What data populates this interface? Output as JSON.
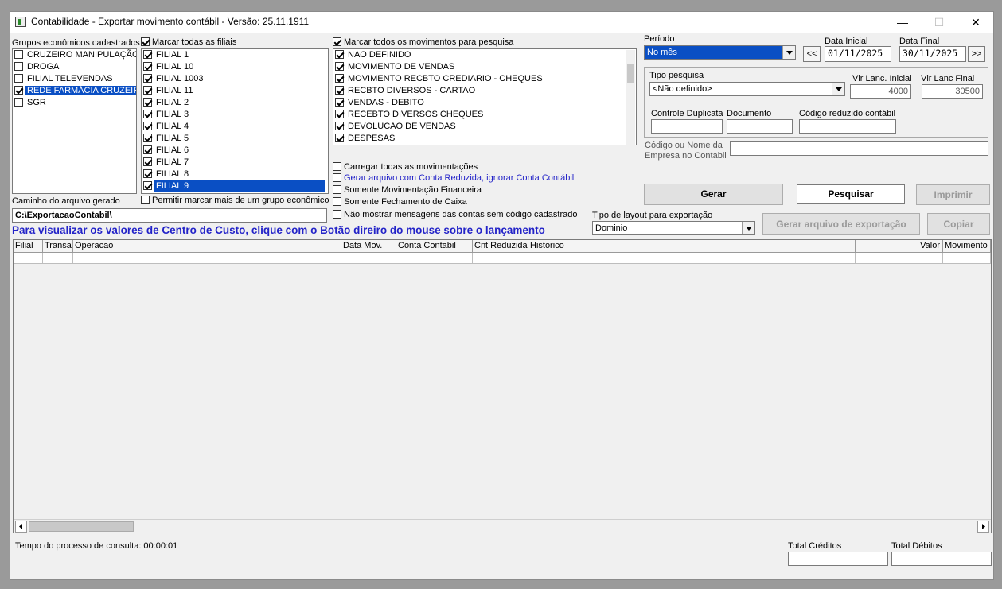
{
  "window": {
    "title": "Contabilidade - Exportar movimento contábil - Versão: 25.11.1911",
    "minimize": "—",
    "maximize": "☐",
    "close": "✕"
  },
  "grupos": {
    "label": "Grupos econômicos cadastrados",
    "items": [
      {
        "label": "CRUZEIRO MANIPULAÇÃO",
        "checked": false,
        "selected": false
      },
      {
        "label": "DROGA",
        "checked": false,
        "selected": false
      },
      {
        "label": "FILIAL TELEVENDAS",
        "checked": false,
        "selected": false
      },
      {
        "label": "REDE FARMÁCIA CRUZEIRO",
        "checked": true,
        "selected": true
      },
      {
        "label": "SGR",
        "checked": false,
        "selected": false
      }
    ]
  },
  "filiais": {
    "label": "Marcar todas as filiais",
    "all_checked": true,
    "items": [
      {
        "label": "FILIAL 1",
        "checked": true,
        "selected": false
      },
      {
        "label": "FILIAL 10",
        "checked": true,
        "selected": false
      },
      {
        "label": "FILIAL 1003",
        "checked": true,
        "selected": false
      },
      {
        "label": "FILIAL 11",
        "checked": true,
        "selected": false
      },
      {
        "label": "FILIAL 2",
        "checked": true,
        "selected": false
      },
      {
        "label": "FILIAL 3",
        "checked": true,
        "selected": false
      },
      {
        "label": "FILIAL 4",
        "checked": true,
        "selected": false
      },
      {
        "label": "FILIAL 5",
        "checked": true,
        "selected": false
      },
      {
        "label": "FILIAL 6",
        "checked": true,
        "selected": false
      },
      {
        "label": "FILIAL 7",
        "checked": true,
        "selected": false
      },
      {
        "label": "FILIAL 8",
        "checked": true,
        "selected": false
      },
      {
        "label": "FILIAL 9",
        "checked": true,
        "selected": true
      }
    ],
    "permitir_label": "Permitir marcar mais de um grupo econômico"
  },
  "movimentos": {
    "label": "Marcar todos os movimentos para pesquisa",
    "all_checked": true,
    "items": [
      "NAO DEFINIDO",
      "MOVIMENTO DE VENDAS",
      "MOVIMENTO RECBTO CREDIARIO - CHEQUES",
      "RECBTO DIVERSOS - CARTAO",
      "VENDAS - DEBITO",
      "RECEBTO DIVERSOS CHEQUES",
      "DEVOLUCAO DE VENDAS",
      "DESPESAS"
    ]
  },
  "opcoes": {
    "carregar": "Carregar todas as movimentações",
    "gerar_reduzida": "Gerar arquivo com Conta Reduzida, ignorar Conta Contábil",
    "somente_financeira": "Somente Movimentação Financeira",
    "somente_fechamento": "Somente Fechamento de Caixa",
    "nao_mostrar": "Não mostrar mensagens das contas sem código cadastrado"
  },
  "caminho": {
    "label": "Caminho do arquivo gerado",
    "value": "C:\\ExportacaoContabil\\"
  },
  "info_text": "Para visualizar os valores de Centro de Custo, clique com o Botão direiro do mouse sobre o lançamento",
  "periodo": {
    "label": "Período",
    "value": "No mês",
    "prev": "<<",
    "next": ">>",
    "data_inicial_label": "Data Inicial",
    "data_inicial": "01/11/2025",
    "data_final_label": "Data Final",
    "data_final": "30/11/2025"
  },
  "pesquisa": {
    "tipo_label": "Tipo pesquisa",
    "tipo_value": "<Não definido>",
    "vlr_inicial_label": "Vlr Lanc. Inicial",
    "vlr_inicial": "4000",
    "vlr_final_label": "Vlr Lanc Final",
    "vlr_final": "30500",
    "controle_label": "Controle Duplicata",
    "documento_label": "Documento",
    "codigo_reduzido_label": "Código reduzido contábil",
    "empresa_label_1": "Código ou Nome da",
    "empresa_label_2": "Empresa no Contabil"
  },
  "buttons": {
    "gerar": "Gerar",
    "pesquisar": "Pesquisar",
    "imprimir": "Imprimir",
    "gerar_arquivo": "Gerar arquivo de exportação",
    "copiar": "Copiar"
  },
  "layout": {
    "label": "Tipo de layout para exportação",
    "value": "Dominio"
  },
  "grid": {
    "columns": [
      "Filial",
      "Transa",
      "Operacao",
      "Data Mov.",
      "Conta Contabil",
      "Cnt Reduzida",
      "Historico",
      "Valor",
      "Movimento"
    ]
  },
  "footer": {
    "tempo": "Tempo do processo de consulta: 00:00:01",
    "total_creditos": "Total Créditos",
    "total_debitos": "Total Débitos"
  }
}
